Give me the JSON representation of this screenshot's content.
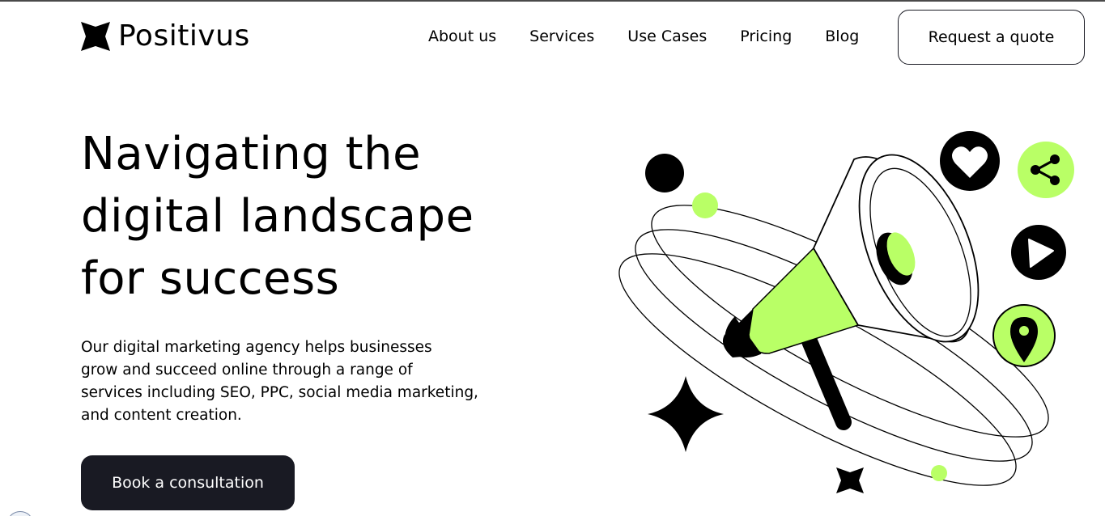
{
  "header": {
    "brand": "Positivus",
    "nav": [
      {
        "label": "About us"
      },
      {
        "label": "Services"
      },
      {
        "label": "Use Cases"
      },
      {
        "label": "Pricing"
      },
      {
        "label": "Blog"
      }
    ],
    "quote_button": "Request a quote"
  },
  "hero": {
    "title_lines": [
      "Navigating the",
      "digital landscape",
      "for success"
    ],
    "description_lines": [
      "Our digital marketing agency helps businesses",
      "grow and succeed online through a range of",
      "services including SEO, PPC, social media marketing,",
      "and content creation."
    ],
    "cta_button": "Book a consultation"
  },
  "colors": {
    "accent": "#B9FF66",
    "dark": "#191A23",
    "background": "#FFFFFF"
  },
  "icons": [
    "logo-star-icon",
    "heart-icon",
    "share-icon",
    "play-icon",
    "location-pin-icon",
    "megaphone-illustration",
    "sparkle-star-icon"
  ]
}
